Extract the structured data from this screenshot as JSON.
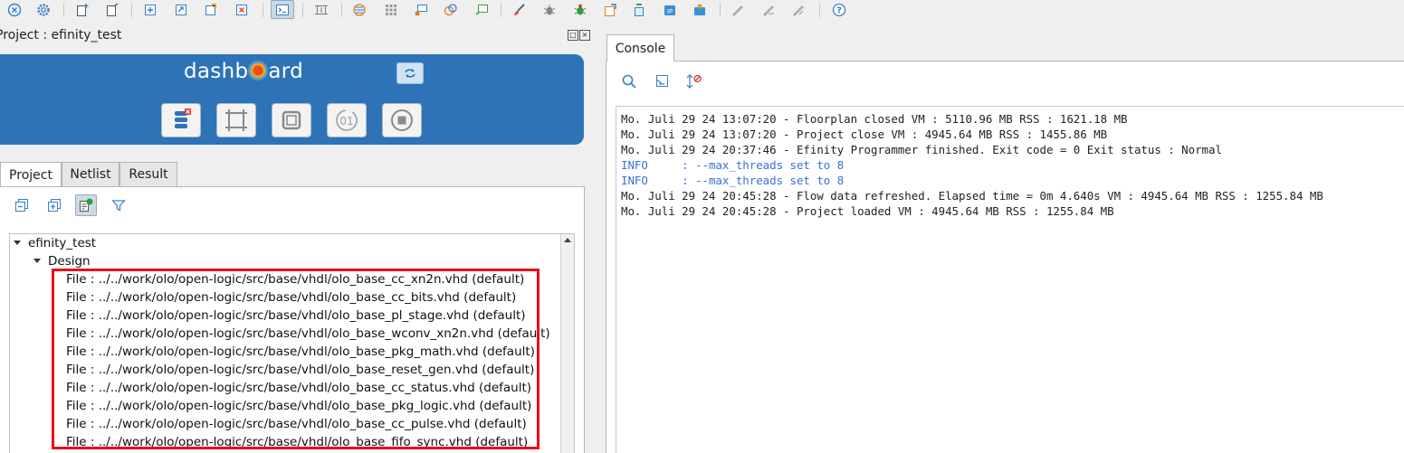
{
  "colors": {
    "accent": "#2e73b8",
    "info": "#3a6fd6",
    "highlight": "#e8101a",
    "text": "#222222"
  },
  "toolbar": {
    "icons": [
      "close-circle-icon",
      "gear-icon",
      "new-file-icon",
      "open-file-icon",
      "add-file-icon",
      "import-file-icon",
      "edit-file-icon",
      "remove-file-icon",
      "terminal-icon",
      "floorplan-icon",
      "timing-icon",
      "grid-icon",
      "interface-icon",
      "pin-icon",
      "bitstream-icon",
      "brush-icon",
      "debug-icon",
      "bug-icon",
      "package-icon",
      "programmer-icon",
      "ip-catalog-icon",
      "ip-manager-icon",
      "pen-icon",
      "pen-alt-icon",
      "pen-alt2-icon",
      "help-icon"
    ]
  },
  "project": {
    "title": "Project : efinity_test",
    "dashboard_title_prefix": "dashb",
    "dashboard_title_suffix": "ard",
    "tabs": [
      "Project",
      "Netlist",
      "Result"
    ],
    "active_tab": "Project",
    "tree": {
      "root": "efinity_test",
      "group": "Design",
      "files": [
        "File : ../../work/olo/open-logic/src/base/vhdl/olo_base_cc_xn2n.vhd (default)",
        "File : ../../work/olo/open-logic/src/base/vhdl/olo_base_cc_bits.vhd (default)",
        "File : ../../work/olo/open-logic/src/base/vhdl/olo_base_pl_stage.vhd (default)",
        "File : ../../work/olo/open-logic/src/base/vhdl/olo_base_wconv_xn2n.vhd (default)",
        "File : ../../work/olo/open-logic/src/base/vhdl/olo_base_pkg_math.vhd (default)",
        "File : ../../work/olo/open-logic/src/base/vhdl/olo_base_reset_gen.vhd (default)",
        "File : ../../work/olo/open-logic/src/base/vhdl/olo_base_cc_status.vhd (default)",
        "File : ../../work/olo/open-logic/src/base/vhdl/olo_base_pkg_logic.vhd (default)",
        "File : ../../work/olo/open-logic/src/base/vhdl/olo_base_cc_pulse.vhd (default)",
        "File : ../../work/olo/open-logic/src/base/vhdl/olo_base_fifo_sync.vhd (default)"
      ]
    }
  },
  "console": {
    "tab_label": "Console",
    "lines": [
      {
        "text": "Mo. Juli 29 24 13:07:20 - Floorplan closed VM : 5110.96 MB RSS : 1621.18 MB",
        "kind": "normal"
      },
      {
        "text": "Mo. Juli 29 24 13:07:20 - Project close VM : 4945.64 MB RSS : 1455.86 MB",
        "kind": "normal"
      },
      {
        "text": "Mo. Juli 29 24 20:37:46 - Efinity Programmer finished. Exit code = 0 Exit status : Normal",
        "kind": "normal"
      },
      {
        "text": "INFO     : --max_threads set to 8",
        "kind": "info"
      },
      {
        "text": "INFO     : --max_threads set to 8",
        "kind": "info"
      },
      {
        "text": "Mo. Juli 29 24 20:45:28 - Flow data refreshed. Elapsed time = 0m 4.640s VM : 4945.64 MB RSS : 1255.84 MB",
        "kind": "normal"
      },
      {
        "text": "Mo. Juli 29 24 20:45:28 - Project loaded VM : 4945.64 MB RSS : 1255.84 MB",
        "kind": "normal"
      }
    ]
  }
}
